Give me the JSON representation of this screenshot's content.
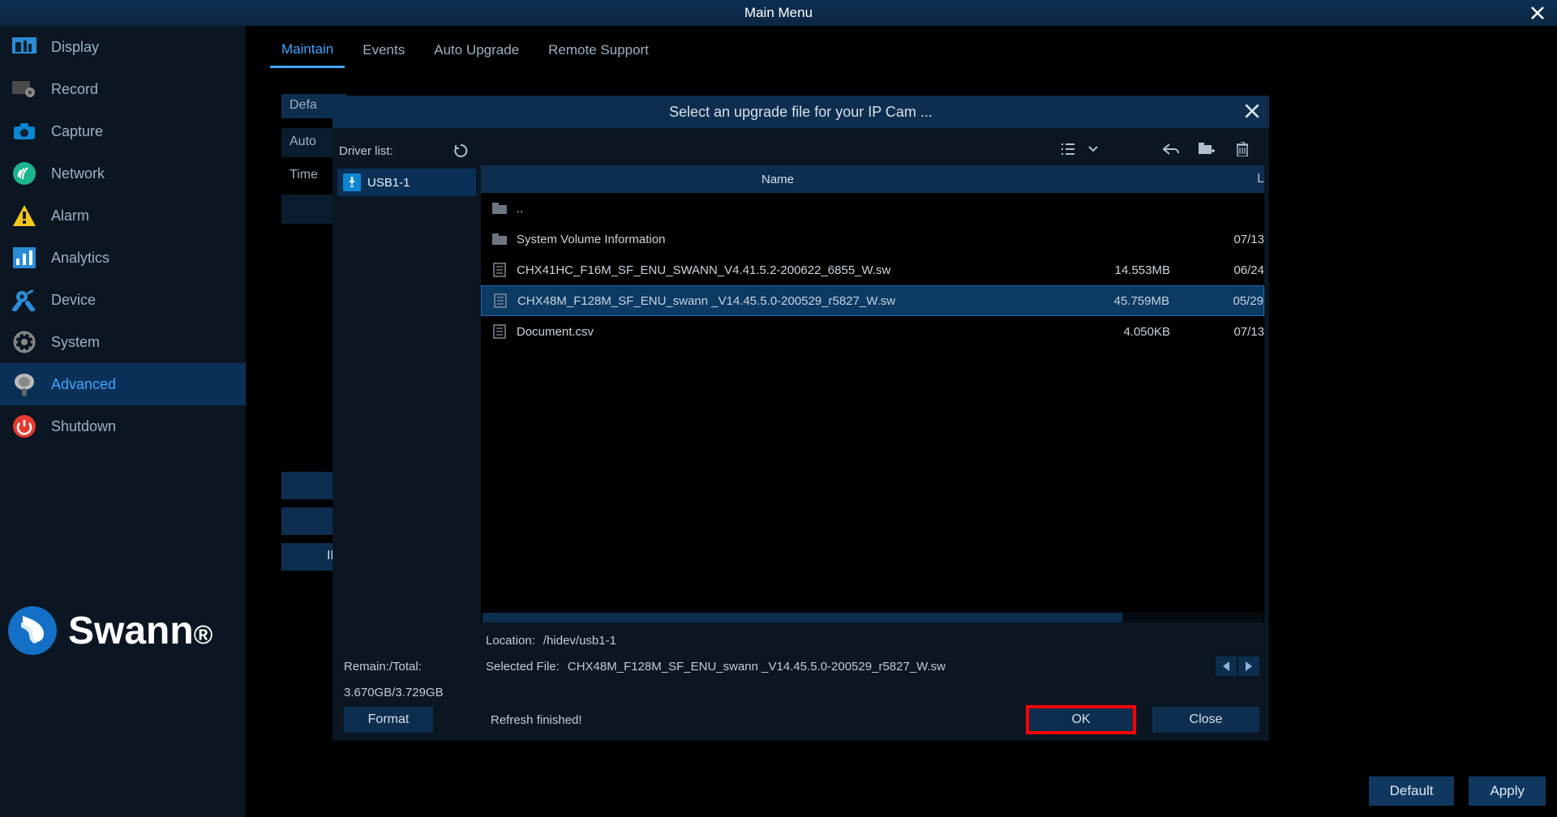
{
  "titlebar": {
    "title": "Main Menu"
  },
  "sidebar": {
    "items": [
      {
        "label": "Display"
      },
      {
        "label": "Record"
      },
      {
        "label": "Capture"
      },
      {
        "label": "Network"
      },
      {
        "label": "Alarm"
      },
      {
        "label": "Analytics"
      },
      {
        "label": "Device"
      },
      {
        "label": "System"
      },
      {
        "label": "Advanced"
      },
      {
        "label": "Shutdown"
      }
    ]
  },
  "brand": {
    "name": "Swann"
  },
  "tabs": [
    {
      "label": "Maintain"
    },
    {
      "label": "Events"
    },
    {
      "label": "Auto Upgrade"
    },
    {
      "label": "Remote Support"
    }
  ],
  "bg_rows": [
    "Defa",
    "Auto",
    "Time",
    "IP"
  ],
  "footer": {
    "default": "Default",
    "apply": "Apply"
  },
  "modal": {
    "title": "Select an upgrade file for your IP Cam ...",
    "driver_label": "Driver list:",
    "drivers": [
      {
        "name": "USB1-1"
      }
    ],
    "columns": {
      "name": "Name",
      "size": "",
      "date": "L"
    },
    "files": [
      {
        "name": "..",
        "size": "",
        "date": "",
        "type": "up"
      },
      {
        "name": "System Volume Information",
        "size": "",
        "date": "07/13",
        "type": "folder"
      },
      {
        "name": "CHX41HC_F16M_SF_ENU_SWANN_V4.41.5.2-200622_6855_W.sw",
        "size": "14.553MB",
        "date": "06/24",
        "type": "file"
      },
      {
        "name": "CHX48M_F128M_SF_ENU_swann _V14.45.5.0-200529_r5827_W.sw",
        "size": "45.759MB",
        "date": "05/29",
        "type": "file",
        "selected": true
      },
      {
        "name": "Document.csv",
        "size": "4.050KB",
        "date": "07/13",
        "type": "file"
      }
    ],
    "location_label": "Location:",
    "location": "/hidev/usb1-1",
    "selected_label": "Selected File:",
    "selected_file": "CHX48M_F128M_SF_ENU_swann _V14.45.5.0-200529_r5827_W.sw",
    "remain_label": "Remain:/Total:",
    "remain_value": "3.670GB/3.729GB",
    "status": "Refresh finished!",
    "format": "Format",
    "ok": "OK",
    "close": "Close"
  }
}
